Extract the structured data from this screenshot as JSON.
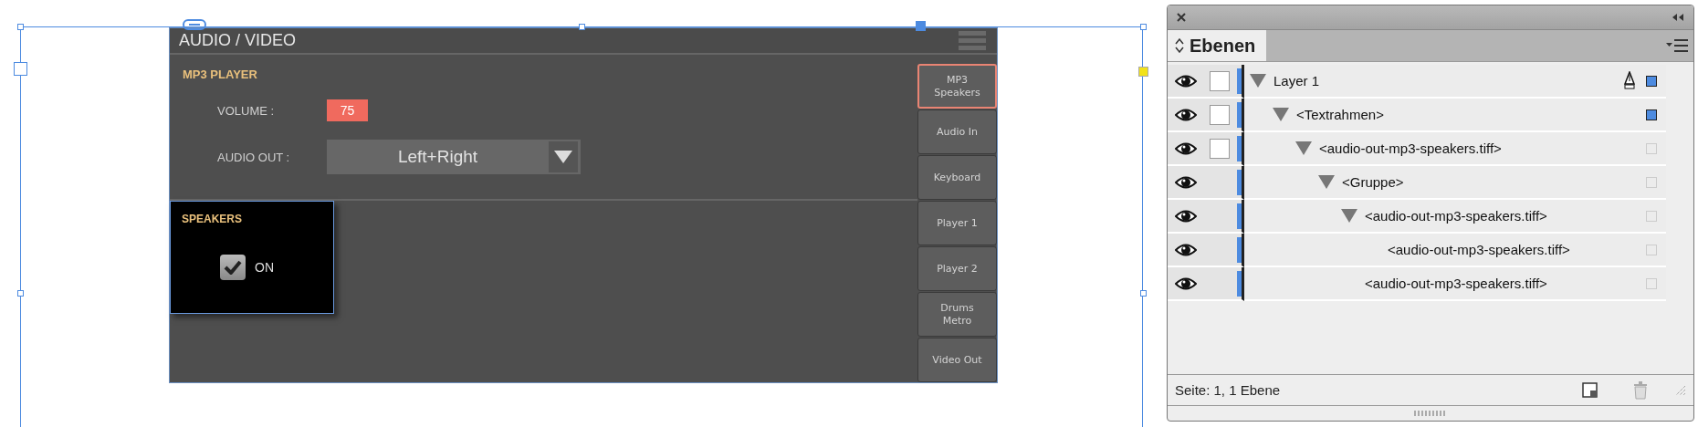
{
  "document": {
    "title": "AUDIO / VIDEO",
    "section": "MP3 PLAYER",
    "volume": {
      "label": "VOLUME :",
      "value": "75"
    },
    "audio_out": {
      "label": "AUDIO OUT :",
      "value": "Left+Right"
    },
    "speakers": {
      "title": "SPEAKERS",
      "checkbox": {
        "label": "ON",
        "checked": true
      }
    },
    "tabs": [
      {
        "label": "MP3\nSpeakers",
        "selected": true
      },
      {
        "label": "Audio In",
        "selected": false
      },
      {
        "label": "Keyboard",
        "selected": false
      },
      {
        "label": "Player 1",
        "selected": false
      },
      {
        "label": "Player 2",
        "selected": false
      },
      {
        "label": "Drums\nMetro",
        "selected": false
      },
      {
        "label": "Video Out",
        "selected": false
      }
    ]
  },
  "layers_panel": {
    "tab": "Ebenen",
    "layers": [
      {
        "label": "Layer 1",
        "expanded": true,
        "selected": true,
        "lock_box": true,
        "children": [
          {
            "label": "<Textrahmen>",
            "expanded": true,
            "selected": true,
            "lock_box": true,
            "children": [
              {
                "label": "<audio-out-mp3-speakers.tiff>",
                "expanded": true,
                "selected": false,
                "lock_box": true,
                "children": [
                  {
                    "label": "<Gruppe>",
                    "expanded": true,
                    "selected": false,
                    "lock_box": false,
                    "children": [
                      {
                        "label": "<audio-out-mp3-speakers.tiff>",
                        "expanded": true,
                        "selected": false,
                        "lock_box": false,
                        "children": [
                          {
                            "label": "<audio-out-mp3-speakers.tiff>",
                            "selected": false,
                            "lock_box": false
                          }
                        ]
                      },
                      {
                        "label": "<audio-out-mp3-speakers.tiff>",
                        "selected": false,
                        "lock_box": false
                      }
                    ]
                  }
                ]
              }
            ]
          }
        ]
      }
    ],
    "status": "Seite: 1, 1 Ebene"
  }
}
